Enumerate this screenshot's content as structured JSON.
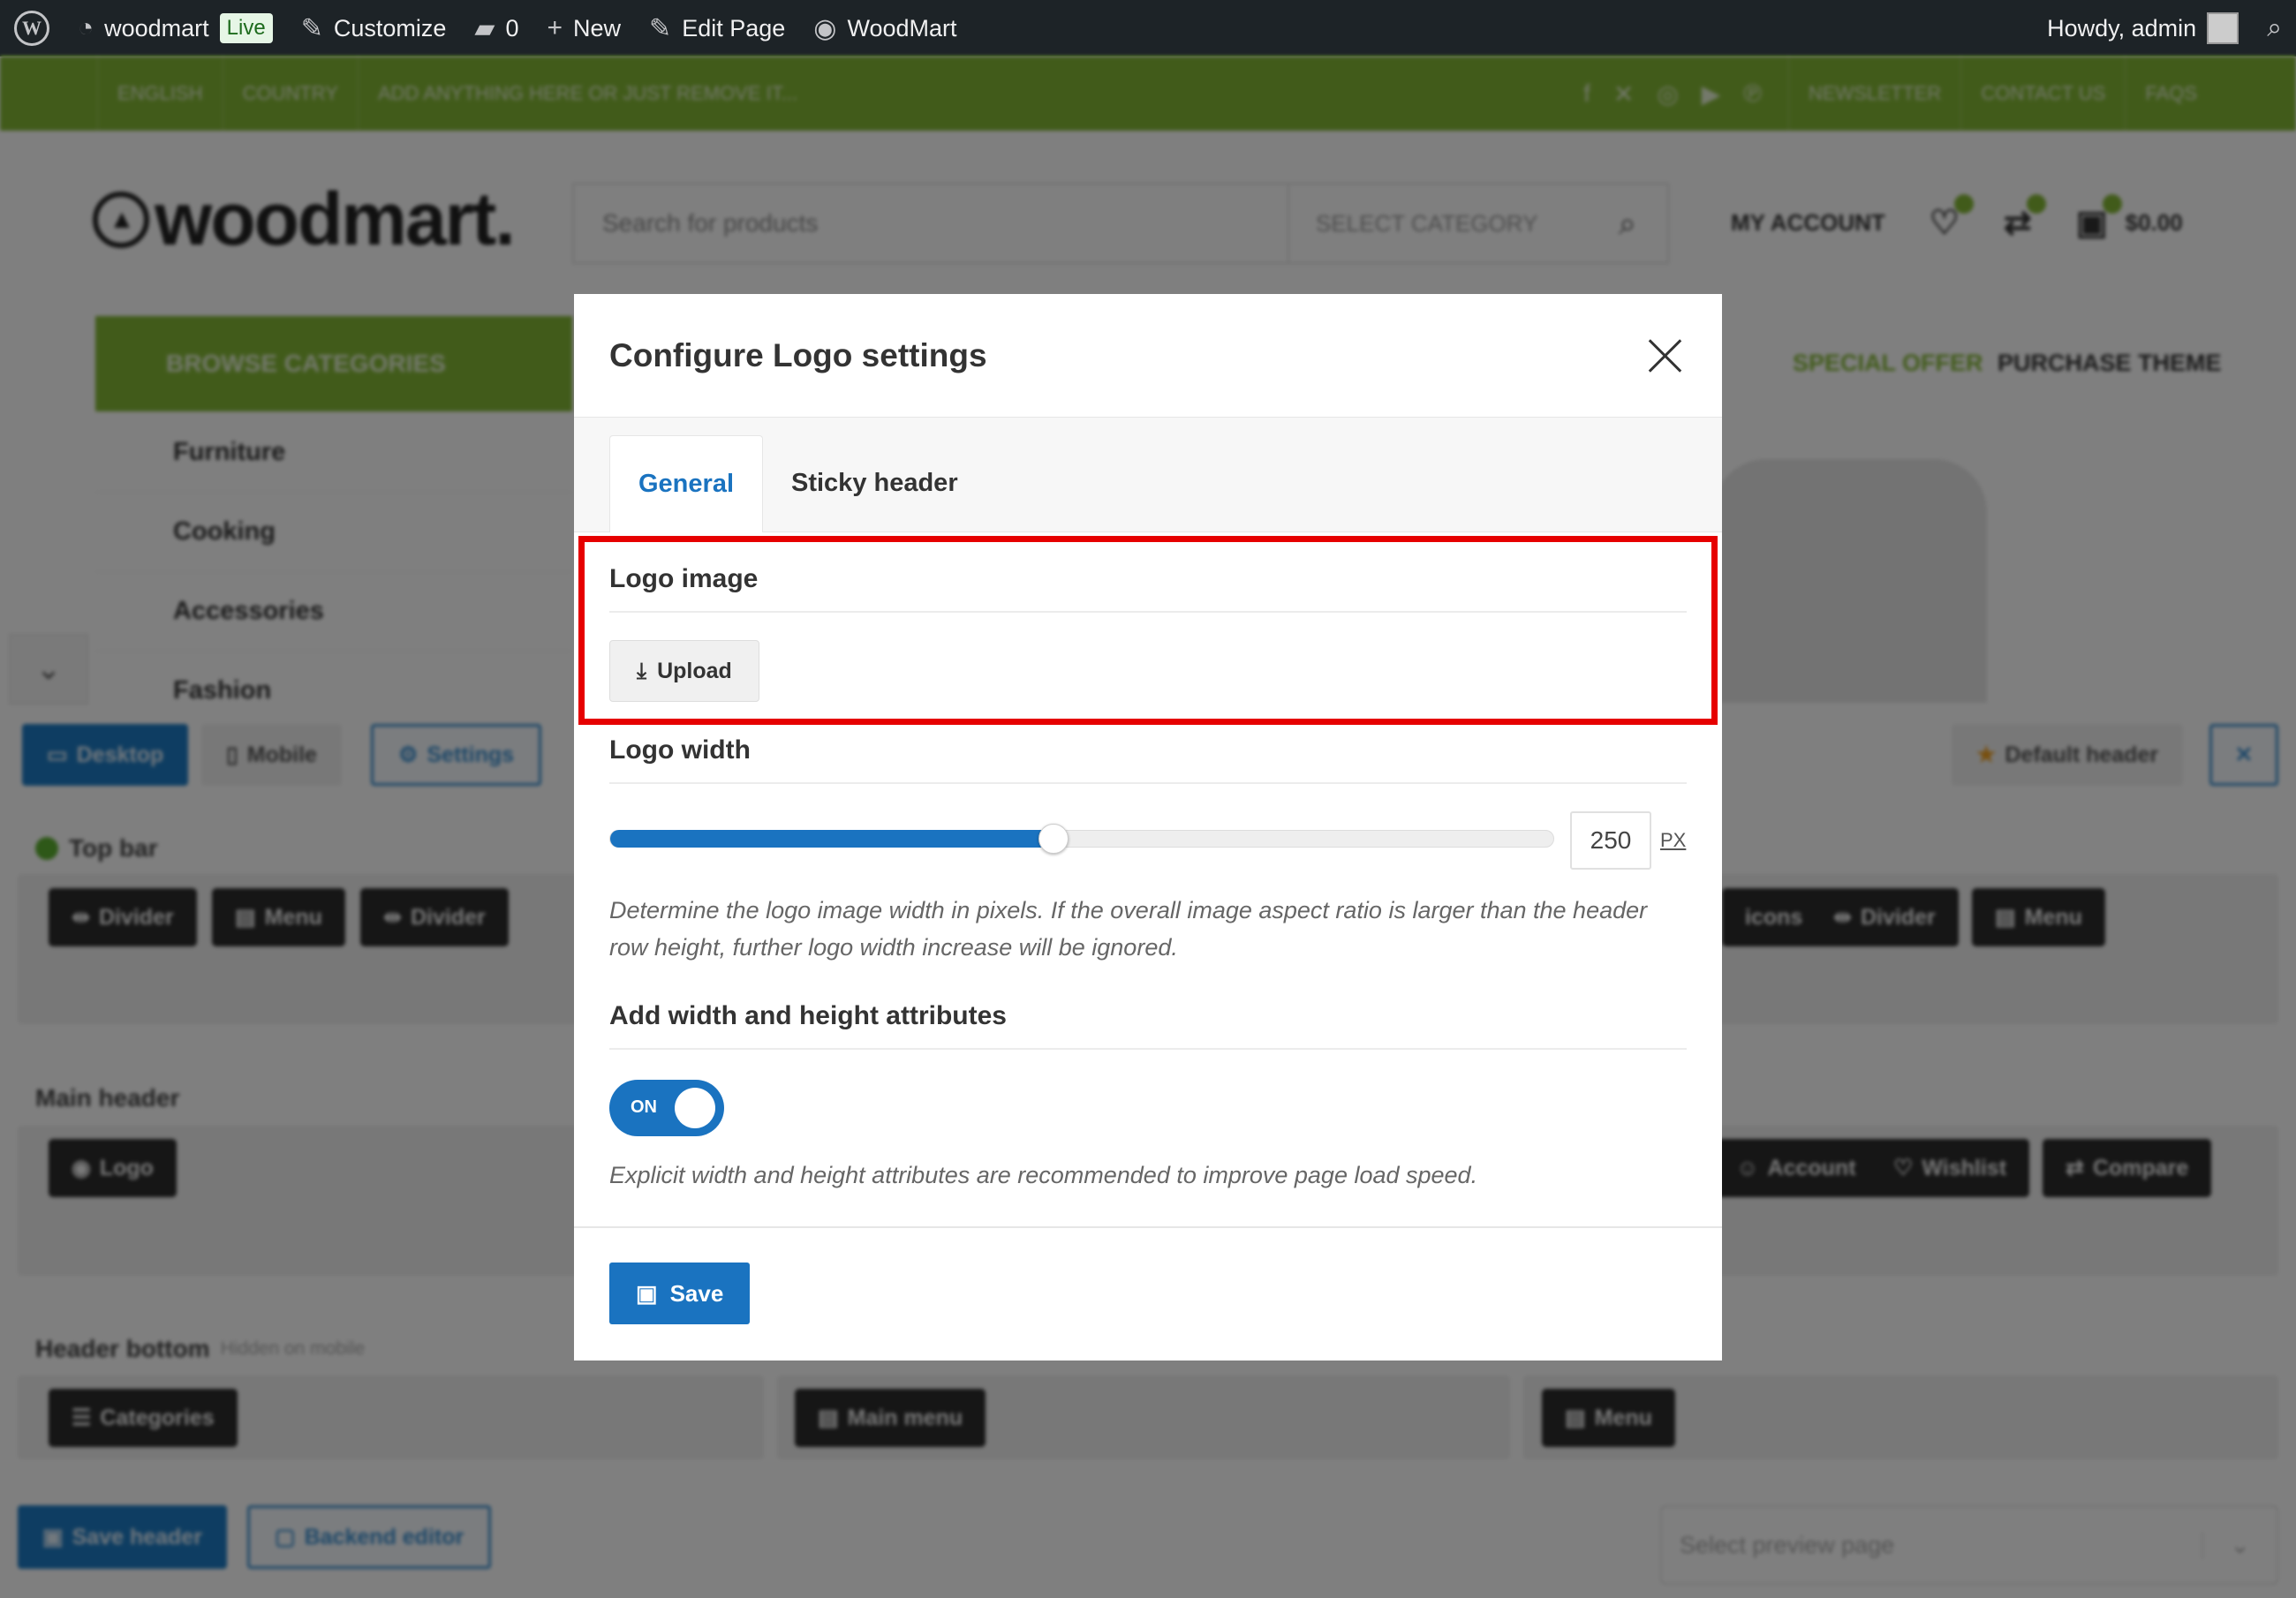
{
  "adminbar": {
    "site_name": "woodmart",
    "live_badge": "Live",
    "customize": "Customize",
    "comments_count": "0",
    "new": "New",
    "edit_page": "Edit Page",
    "woodmart": "WoodMart",
    "howdy": "Howdy, admin"
  },
  "topbar": {
    "language": "ENGLISH",
    "country": "COUNTRY",
    "promo": "ADD ANYTHING HERE OR JUST REMOVE IT...",
    "links": [
      "NEWSLETTER",
      "CONTACT US",
      "FAQS"
    ]
  },
  "header": {
    "logo": "woodmart.",
    "search_placeholder": "Search for products",
    "select_category": "SELECT CATEGORY",
    "my_account": "MY ACCOUNT",
    "cart_total": "$0.00"
  },
  "nav": {
    "browse": "BROWSE CATEGORIES",
    "special_offer": "SPECIAL OFFER",
    "purchase_theme": "PURCHASE THEME",
    "categories": [
      "Furniture",
      "Cooking",
      "Accessories",
      "Fashion"
    ]
  },
  "builder": {
    "desktop": "Desktop",
    "mobile": "Mobile",
    "settings": "Settings",
    "default_header": "Default header",
    "top_bar": "Top bar",
    "main_header": "Main header",
    "header_bottom": "Header bottom",
    "hidden_on_mobile": "Hidden on mobile",
    "top_chips_left": [
      "Divider",
      "Menu",
      "Divider"
    ],
    "top_chips_right": [
      "icons",
      "Divider",
      "Menu"
    ],
    "main_chips_left": [
      "Logo"
    ],
    "main_chips_right": [
      "Account",
      "Wishlist",
      "Compare"
    ],
    "bottom_chips": [
      "Categories",
      "Main menu",
      "Menu"
    ],
    "save_header": "Save header",
    "backend_editor": "Backend editor",
    "select_preview": "Select preview page"
  },
  "modal": {
    "title": "Configure Logo settings",
    "tabs": [
      "General",
      "Sticky header"
    ],
    "logo_image_title": "Logo image",
    "upload_label": "Upload",
    "logo_width_title": "Logo width",
    "logo_width_value": "250",
    "logo_width_fraction": 0.47,
    "logo_width_unit": "PX",
    "logo_width_desc": "Determine the logo image width in pixels. If the overall image aspect ratio is larger than the header row height, further logo width increase will be ignored.",
    "attrs_title": "Add width and height attributes",
    "toggle_label": "ON",
    "attrs_desc": "Explicit width and height attributes are recommended to improve page load speed.",
    "save_label": "Save"
  },
  "colors": {
    "brand_green": "#83b735",
    "accent_blue": "#1a73c0",
    "highlight_red": "#e60000"
  }
}
